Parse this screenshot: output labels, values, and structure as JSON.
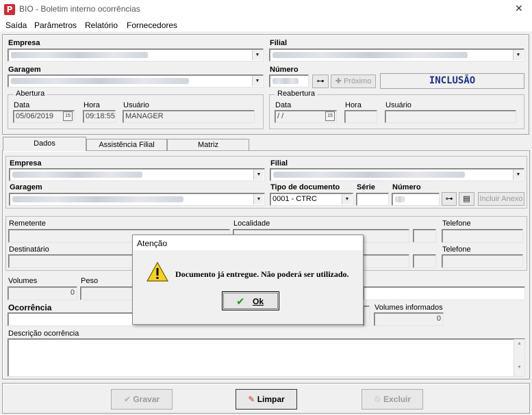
{
  "window": {
    "title": "BIO - Boletim interno ocorrências",
    "icon_letter": "P",
    "close_glyph": "✕"
  },
  "menu": [
    "Saída",
    "Parâmetros",
    "Relatório",
    "Fornecedores"
  ],
  "header": {
    "empresa_label": "Empresa",
    "filial_label": "Filial",
    "garagem_label": "Garagem",
    "numero_label": "Número",
    "proximo_button": "Próximo",
    "mode_text": "INCLUSÃO"
  },
  "abertura": {
    "title": "Abertura",
    "data_label": "Data",
    "data_value": "05/06/2019",
    "hora_label": "Hora",
    "hora_value": "09:18:55",
    "usuario_label": "Usuário",
    "usuario_value": "MANAGER"
  },
  "reabertura": {
    "title": "Reabertura",
    "data_label": "Data",
    "data_value": " /  /",
    "hora_label": "Hora",
    "usuario_label": "Usuário"
  },
  "tabs": [
    "Dados",
    "Assistência Filial",
    "Matriz"
  ],
  "dados": {
    "empresa_label": "Empresa",
    "filial_label": "Filial",
    "garagem_label": "Garagem",
    "tipo_doc_label": "Tipo de documento",
    "tipo_doc_value": "0001 - CTRC",
    "serie_label": "Série",
    "numero_label": "Número",
    "incluir_anexo": "Incluir Anexo",
    "remetente_label": "Remetente",
    "localidade_label": "Localidade",
    "telefone_label": "Telefone",
    "destinatario_label": "Destinatário",
    "telefone2_label": "Telefone",
    "volumes_label": "Volumes",
    "volumes_value": "0",
    "peso_label": "Peso",
    "ocorrencia_label": "Ocorrência",
    "volumes_informados_label": "Volumes informados",
    "volumes_informados_value": "0",
    "descricao_label": "Descrição ocorrência"
  },
  "footer": {
    "gravar": "Gravar",
    "limpar": "Limpar",
    "excluir": "Excluir"
  },
  "dialog": {
    "title": "Atenção",
    "message": "Documento já entregue. Não poderá ser utilizado.",
    "ok": "Ok"
  },
  "colors": {
    "mode_text": "#1c2f8c",
    "app_icon": "#d9262f",
    "check_green": "#1e9a1e"
  }
}
